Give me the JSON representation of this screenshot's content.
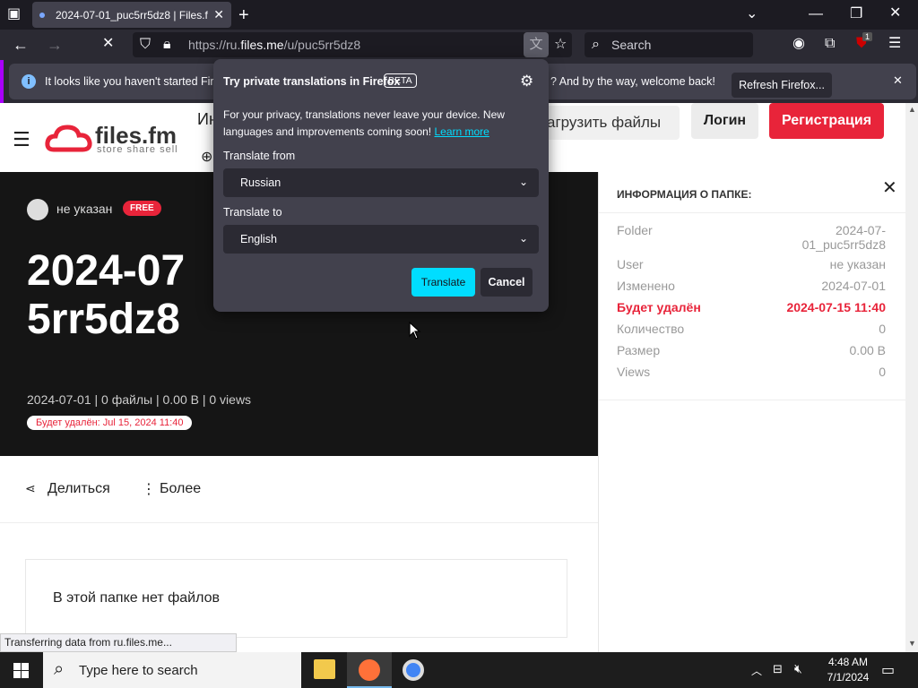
{
  "browser": {
    "tab_title": "2024-07-01_puc5rr5dz8 | Files.fm",
    "url_prefix": "https://ru.",
    "url_domain": "files.me",
    "url_path": "/u/puc5rr5dz8",
    "search_placeholder": "Search",
    "ext_badge": "1"
  },
  "notification": {
    "text_left": "It looks like you haven't started Firef",
    "text_right": "? And by the way, welcome back!",
    "button": "Refresh Firefox..."
  },
  "translation_popup": {
    "title": "Try private translations in Firefox",
    "beta": "BETA",
    "body": "For your privacy, translations never leave your device. New languages and improvements coming soon!",
    "learn_more": "Learn more",
    "from_label": "Translate from",
    "from_value": "Russian",
    "to_label": "Translate to",
    "to_value": "English",
    "translate_button": "Translate",
    "cancel_button": "Cancel"
  },
  "site": {
    "logo_name": "files.fm",
    "logo_tagline": "store share sell",
    "nav_partial": "Ин",
    "upload_button": "агрузить файлы",
    "login_button": "Логин",
    "register_button": "Регистрация"
  },
  "hero": {
    "user": "не указан",
    "plan_badge": "FREE",
    "title_line1": "2024-07",
    "title_line2": "5rr5dz8",
    "meta": "2024-07-01 | 0 файлы | 0.00 B | 0 views",
    "delete_badge": "Будет удалён: Jul 15, 2024 11:40"
  },
  "actions": {
    "share": "Делиться",
    "more": "Более"
  },
  "empty_message": "В этой папке нет файлов",
  "status_bar": "Transferring data from ru.files.me...",
  "sidepanel": {
    "heading": "ИНФОРМАЦИЯ О ПАПКЕ:",
    "rows": [
      {
        "label": "Folder",
        "value": "2024-07-01_puc5rr5dz8"
      },
      {
        "label": "User",
        "value": "не указан"
      },
      {
        "label": "Изменено",
        "value": "2024-07-01"
      },
      {
        "label": "Будет удалён",
        "value": "2024-07-15 11:40"
      },
      {
        "label": "Количество",
        "value": "0"
      },
      {
        "label": "Размер",
        "value": "0.00 B"
      },
      {
        "label": "Views",
        "value": "0"
      }
    ]
  },
  "taskbar": {
    "search_placeholder": "Type here to search",
    "time": "4:48 AM",
    "date": "7/1/2024"
  },
  "colors": {
    "accent_red": "#e8243a",
    "translate_btn": "#00ddff"
  }
}
